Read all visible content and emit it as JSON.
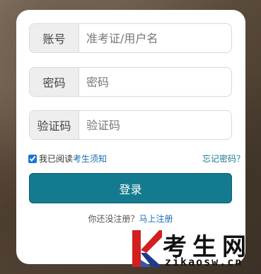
{
  "form": {
    "account": {
      "label": "账号",
      "placeholder": "准考证/用户名"
    },
    "password": {
      "label": "密码",
      "placeholder": "密码"
    },
    "captcha": {
      "label": "验证码",
      "placeholder": "验证码"
    }
  },
  "options": {
    "agree_prefix": "我已阅读",
    "agree_link": "考生须知",
    "agree_checked": true,
    "forgot": "忘记密码？"
  },
  "login_label": "登录",
  "register": {
    "prefix": "你还没注册？",
    "link": "马上注册"
  },
  "watermark": {
    "cn": "考生网",
    "en": "zikaosw.cn",
    "colors": {
      "red": "#d21f1f",
      "blue": "#1e3a8a"
    }
  }
}
